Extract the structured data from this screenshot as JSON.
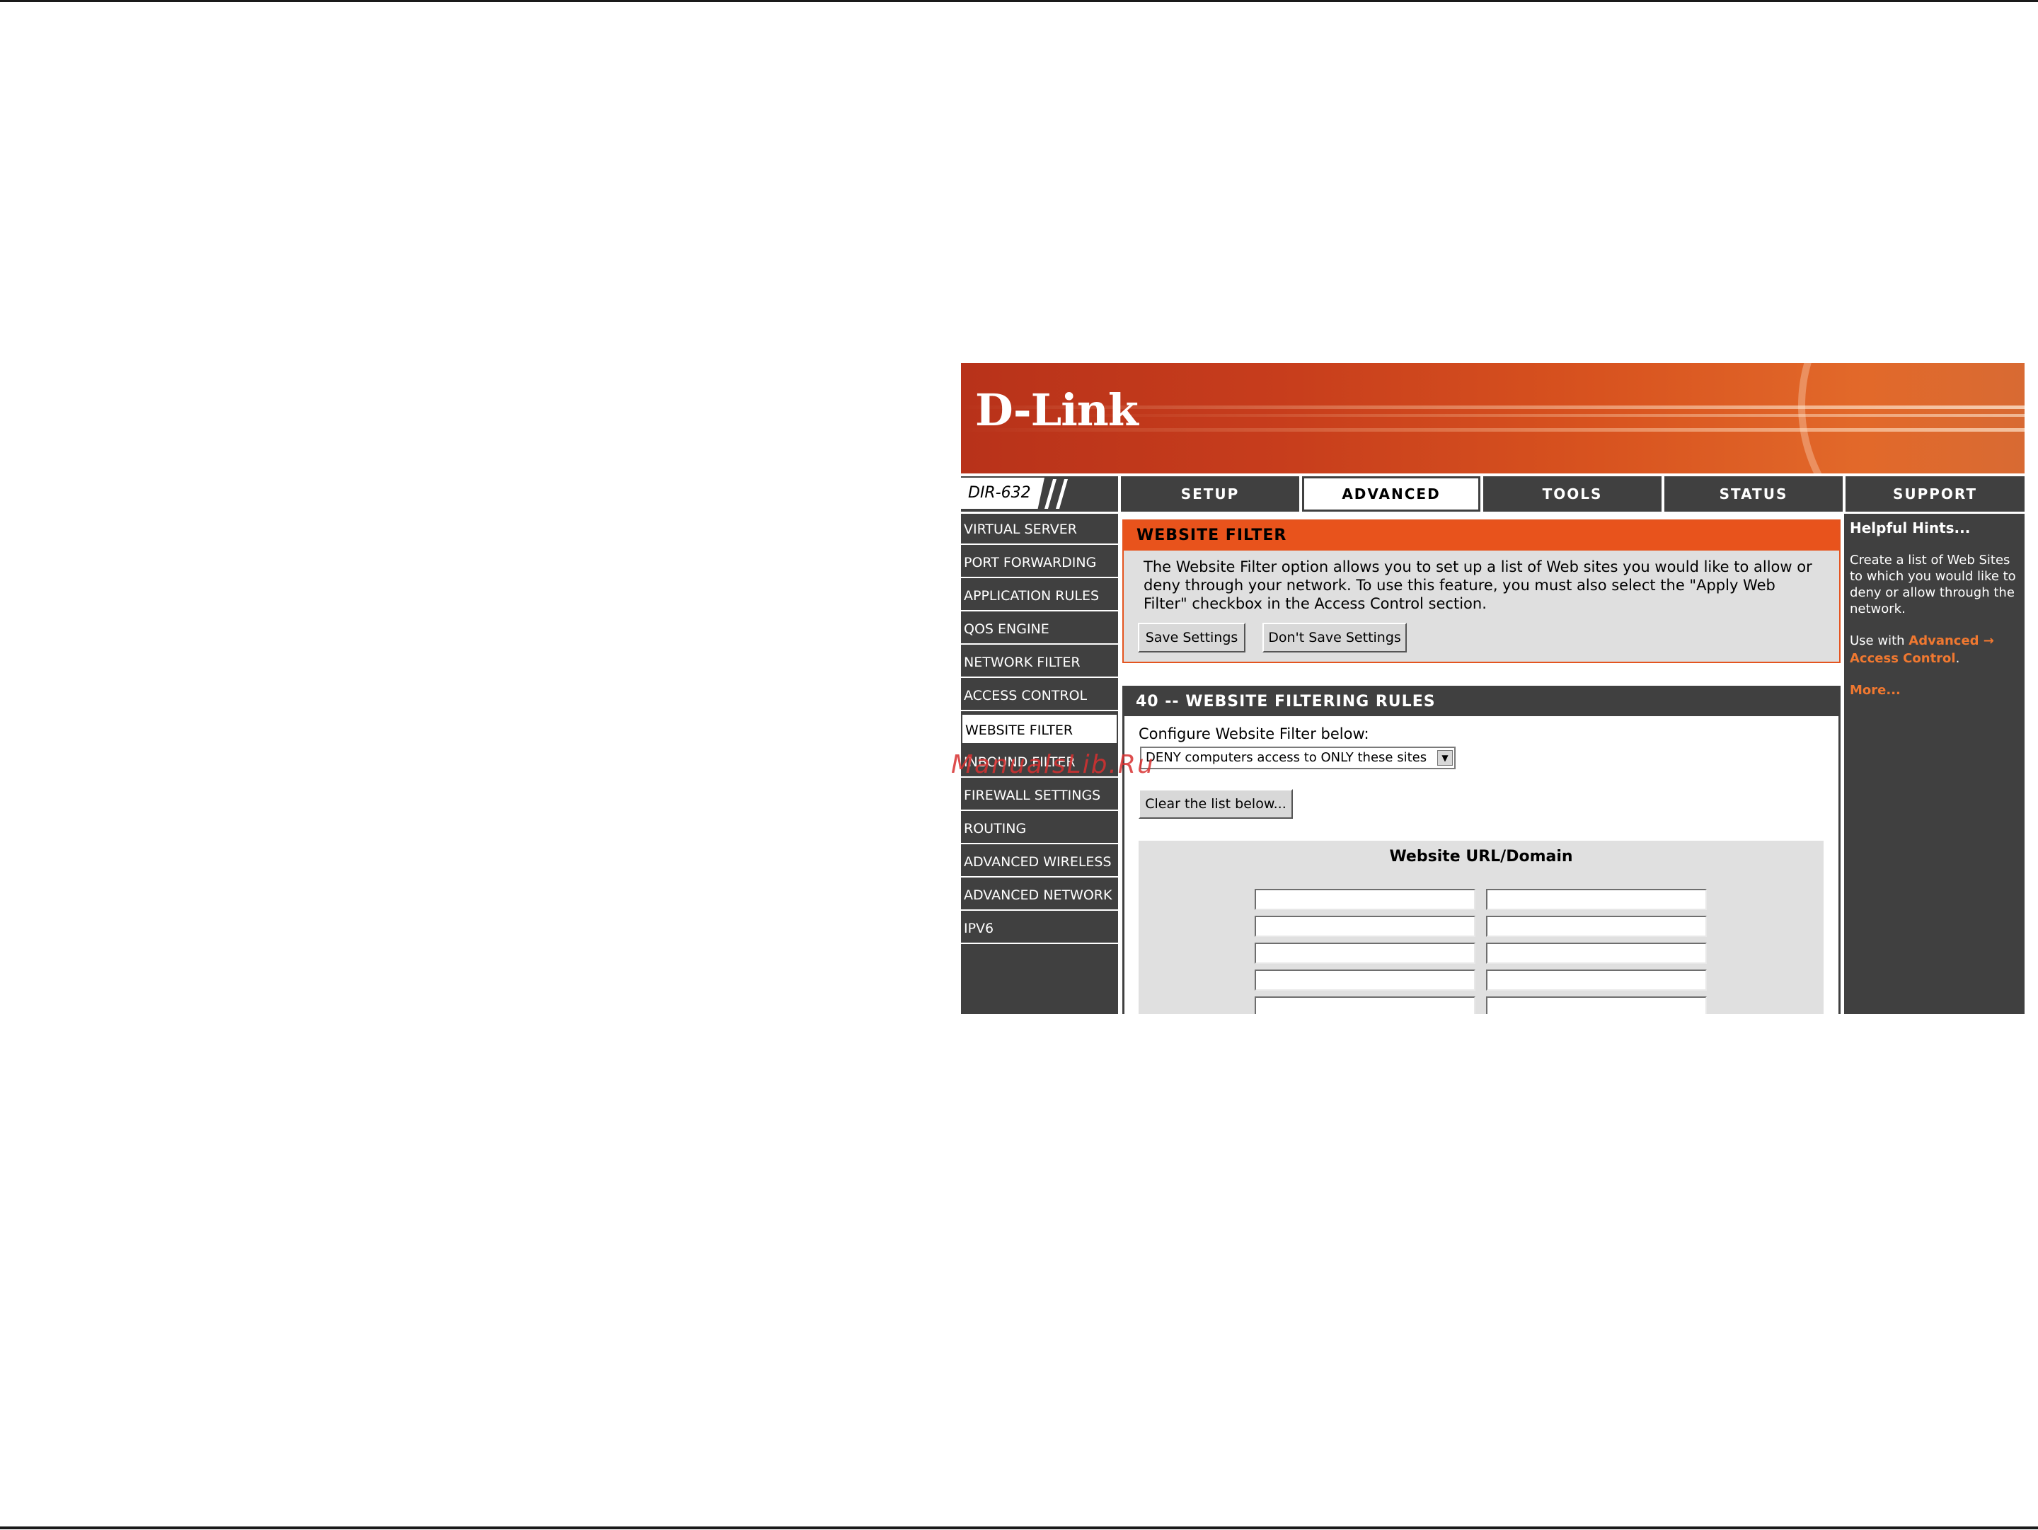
{
  "brand": {
    "logo_text": "D-Link",
    "banner_color": "#d0451e"
  },
  "model": {
    "name": "DIR-632"
  },
  "nav": {
    "tabs": [
      {
        "label": "SETUP",
        "active": false
      },
      {
        "label": "ADVANCED",
        "active": true
      },
      {
        "label": "TOOLS",
        "active": false
      },
      {
        "label": "STATUS",
        "active": false
      },
      {
        "label": "SUPPORT",
        "active": false
      }
    ]
  },
  "sidebar": {
    "items": [
      {
        "label": "VIRTUAL SERVER",
        "active": false
      },
      {
        "label": "PORT FORWARDING",
        "active": false
      },
      {
        "label": "APPLICATION RULES",
        "active": false
      },
      {
        "label": "QOS ENGINE",
        "active": false
      },
      {
        "label": "NETWORK FILTER",
        "active": false
      },
      {
        "label": "ACCESS CONTROL",
        "active": false
      },
      {
        "label": "WEBSITE FILTER",
        "active": true
      },
      {
        "label": "INBOUND FILTER",
        "active": false
      },
      {
        "label": "FIREWALL SETTINGS",
        "active": false
      },
      {
        "label": "ROUTING",
        "active": false
      },
      {
        "label": "ADVANCED WIRELESS",
        "active": false
      },
      {
        "label": "ADVANCED NETWORK",
        "active": false
      },
      {
        "label": "IPV6",
        "active": false
      }
    ]
  },
  "website_filter": {
    "title": "WEBSITE FILTER",
    "description": "The Website Filter option allows you to set up a list of Web sites you would like to allow or deny through your network. To use this feature, you must also select the \"Apply Web Filter\" checkbox in the Access Control section.",
    "save_label": "Save Settings",
    "dont_save_label": "Don't Save Settings"
  },
  "rules": {
    "title": "40 -- WEBSITE FILTERING RULES",
    "config_label": "Configure Website Filter below:",
    "selected_option": "DENY computers access to ONLY these sites",
    "clear_label": "Clear the list below...",
    "url_column_title": "Website URL/Domain",
    "url_rows": [
      [
        "",
        ""
      ],
      [
        "",
        ""
      ],
      [
        "",
        ""
      ],
      [
        "",
        ""
      ],
      [
        "",
        ""
      ]
    ]
  },
  "hints": {
    "title": "Helpful Hints...",
    "text": "Create a list of Web Sites to which you would like to deny or allow through the network.",
    "use_prefix": "Use with ",
    "link_label": "Advanced → Access Control",
    "use_suffix": ".",
    "more_label": "More..."
  },
  "watermark": {
    "text": "ManualsLib.Ru"
  },
  "colors": {
    "dark_gray": "#404040",
    "orange": "#e8531c",
    "link_orange": "#f07830"
  }
}
